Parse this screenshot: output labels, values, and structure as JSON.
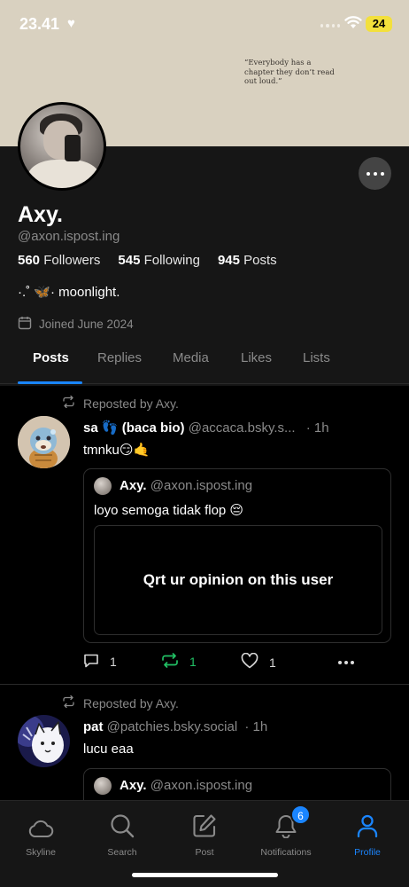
{
  "status_bar": {
    "time": "23.41",
    "battery": "24"
  },
  "banner": {
    "quote": "“Everybody has a chapter they don’t read out loud.”"
  },
  "profile": {
    "display_name": "Axy.",
    "handle": "@axon.ispost.ing",
    "followers_count": "560",
    "followers_label": "Followers",
    "following_count": "545",
    "following_label": "Following",
    "posts_count": "945",
    "posts_label": "Posts",
    "bio": "·.˚ 🦋· moonlight.",
    "joined": "Joined June 2024"
  },
  "tabs": [
    "Posts",
    "Replies",
    "Media",
    "Likes",
    "Lists"
  ],
  "feed": [
    {
      "repost_label": "Reposted by Axy.",
      "author_name": "sa 👣 (baca bio)",
      "author_handle": "@accaca.bsky.s...",
      "time": "· 1h",
      "text": "tmnku😏🤙",
      "quote": {
        "author_name": "Axy.",
        "author_handle": "@axon.ispost.ing",
        "text": "loyo semoga tidak flop 😔",
        "embed_text": "Qrt ur opinion on this user"
      },
      "replies": "1",
      "reposts": "1",
      "likes": "1"
    },
    {
      "repost_label": "Reposted by Axy.",
      "author_name": "pat",
      "author_handle": "@patchies.bsky.social",
      "time": "· 1h",
      "text": "lucu eaa",
      "quote": {
        "author_name": "Axy.",
        "author_handle": "@axon.ispost.ing"
      }
    }
  ],
  "nav": {
    "skyline": "Skyline",
    "search": "Search",
    "post": "Post",
    "notifications": "Notifications",
    "notifications_badge": "6",
    "profile": "Profile"
  },
  "colors": {
    "accent": "#1a85ff",
    "repost_green": "#21c064",
    "banner": "#d9d1c0"
  }
}
